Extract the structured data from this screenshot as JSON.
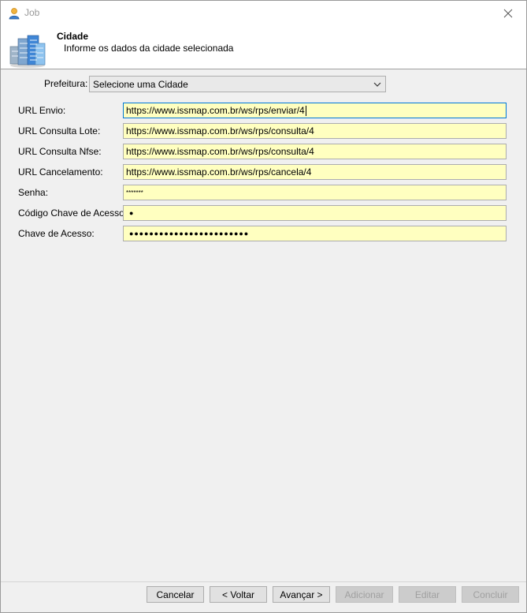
{
  "window": {
    "title": "Job"
  },
  "header": {
    "title": "Cidade",
    "subtitle": "Informe os dados da cidade selecionada"
  },
  "form": {
    "prefeitura_label": "Prefeitura:",
    "prefeitura_value": "Selecione uma Cidade",
    "fields": [
      {
        "label": "URL Envio:",
        "value": "https://www.issmap.com.br/ws/rps/enviar/4"
      },
      {
        "label": "URL Consulta Lote:",
        "value": "https://www.issmap.com.br/ws/rps/consulta/4"
      },
      {
        "label": "URL Consulta Nfse:",
        "value": "https://www.issmap.com.br/ws/rps/consulta/4"
      },
      {
        "label": "URL Cancelamento:",
        "value": "https://www.issmap.com.br/ws/rps/cancela/4"
      },
      {
        "label": "Senha:",
        "value": "*******"
      },
      {
        "label": "Código Chave de Acesso:",
        "value": "●"
      },
      {
        "label": "Chave de Acesso:",
        "value": "●●●●●●●●●●●●●●●●●●●●●●●●"
      }
    ]
  },
  "buttons": {
    "cancel": "Cancelar",
    "back": "< Voltar",
    "next": "Avançar >",
    "add": "Adicionar",
    "edit": "Editar",
    "finish": "Concluir"
  },
  "colors": {
    "field_bg": "#ffffc0",
    "focus_border": "#0078d7"
  }
}
